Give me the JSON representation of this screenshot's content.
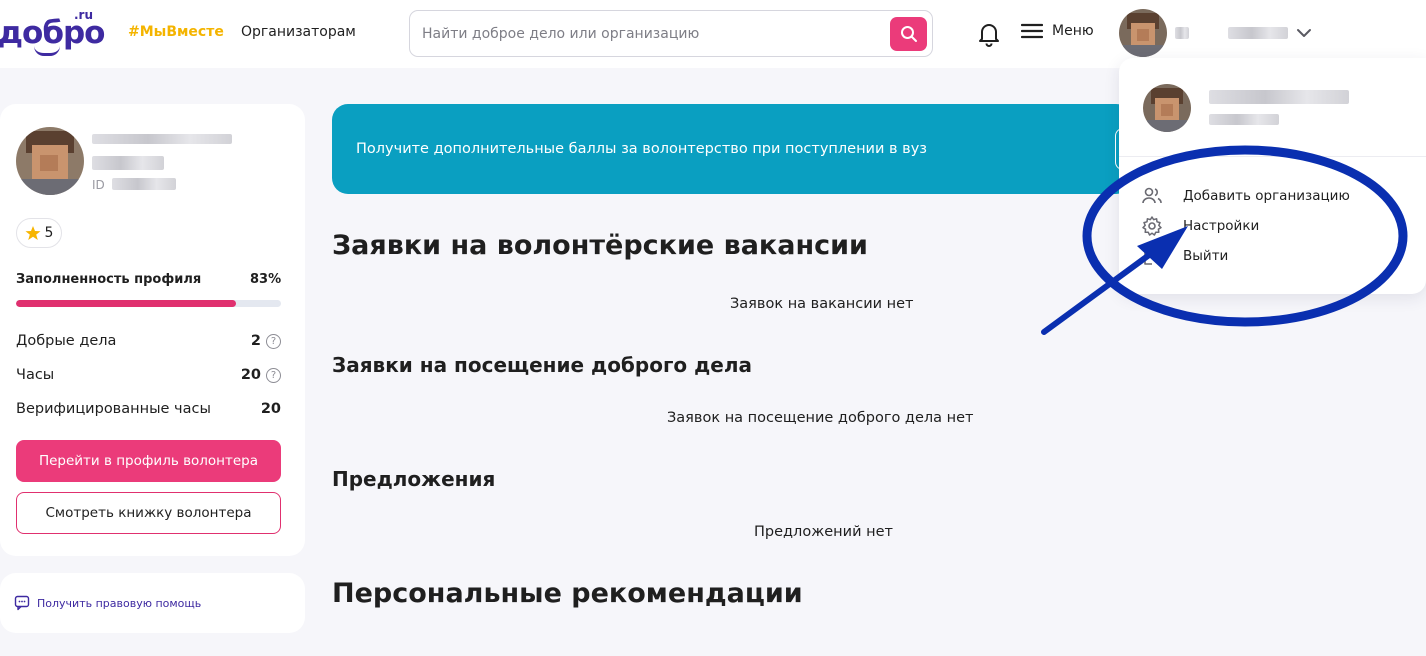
{
  "header": {
    "logo_text": "добро",
    "logo_suffix": ".ru",
    "hashtag": "#МыВместе",
    "organizers_link": "Организаторам",
    "search_placeholder": "Найти доброе дело или организацию",
    "menu_label": "Меню"
  },
  "banner": {
    "text": "Получите дополнительные баллы за волонтерство при поступлении в вуз"
  },
  "profile": {
    "id_prefix": "ID",
    "rating": "5",
    "completeness_label": "Заполненность профиля",
    "completeness_value": "83%",
    "completeness_fraction": 0.83,
    "stats": [
      {
        "label": "Добрые дела",
        "value": "2",
        "has_help": true
      },
      {
        "label": "Часы",
        "value": "20",
        "has_help": true
      },
      {
        "label": "Верифицированные часы",
        "value": "20",
        "has_help": false
      }
    ],
    "primary_button": "Перейти в профиль волонтера",
    "secondary_button": "Смотреть книжку волонтера",
    "legal_help": "Получить правовую помощь"
  },
  "main": {
    "vacancies_title": "Заявки на волонтёрские вакансии",
    "vacancies_empty": "Заявок на вакансии нет",
    "visits_title": "Заявки на посещение доброго дела",
    "visits_empty": "Заявок на посещение доброго дела нет",
    "offers_title": "Предложения",
    "offers_empty": "Предложений нет",
    "recommendations_title": "Персональные рекомендации"
  },
  "dropdown": {
    "items": [
      {
        "label": "Добавить организацию",
        "icon": "users-icon"
      },
      {
        "label": "Настройки",
        "icon": "gear-icon"
      },
      {
        "label": "Выйти",
        "icon": "logout-icon"
      }
    ]
  },
  "colors": {
    "brand": "#3e2aa1",
    "accent_pink": "#eb3b7a",
    "banner": "#0a9fc1",
    "hashtag": "#f4b400",
    "annotation": "#0a2fb0"
  }
}
